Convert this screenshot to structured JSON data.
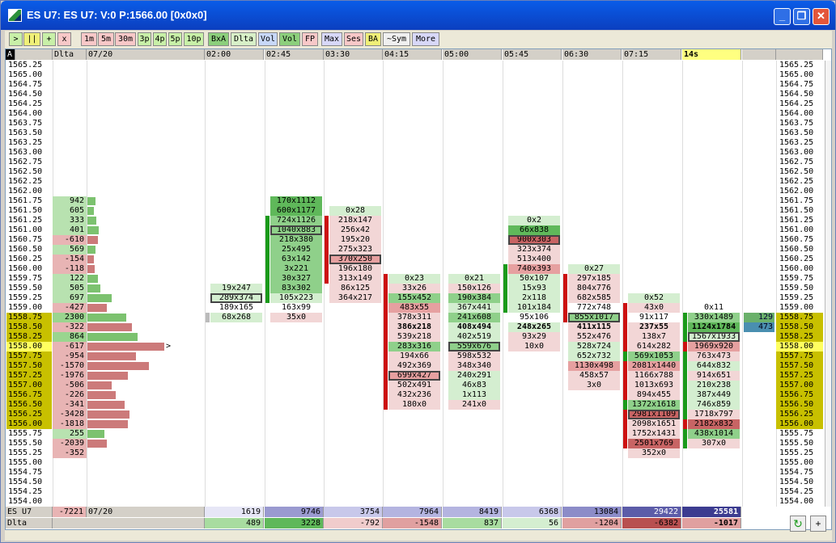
{
  "window": {
    "title": "ES U7: ES U7: V:0 P:1566.00 [0x0x0]"
  },
  "toolbar": {
    "buttons": [
      {
        "label": ">",
        "color": "#c8f0a8"
      },
      {
        "label": "||",
        "color": "#f0f078"
      },
      {
        "label": "+",
        "color": "#c8f0a8"
      },
      {
        "label": "x",
        "color": "#f8c8c8"
      },
      {
        "label": "1m",
        "color": "#f8c8c8"
      },
      {
        "label": "5m",
        "color": "#f8c8c8"
      },
      {
        "label": "30m",
        "color": "#f8c8c8"
      },
      {
        "label": "3p",
        "color": "#c8f0a8"
      },
      {
        "label": "4p",
        "color": "#c8f0a8"
      },
      {
        "label": "5p",
        "color": "#c8f0a8"
      },
      {
        "label": "10p",
        "color": "#c8f0a8"
      },
      {
        "label": "BxA",
        "color": "#8ccf7c"
      },
      {
        "label": "Dlta",
        "color": "#d8f0c8"
      },
      {
        "label": "Vol",
        "color": "#c8d8f8"
      },
      {
        "label": "Vol",
        "color": "#8ccf7c"
      },
      {
        "label": "FP",
        "color": "#f8c8c8"
      },
      {
        "label": "Max",
        "color": "#d8d8f8"
      },
      {
        "label": "Ses",
        "color": "#f8c8c8"
      },
      {
        "label": "BA",
        "color": "#f0f078"
      },
      {
        "label": "~Sym",
        "color": "#f0f0f0"
      },
      {
        "label": "More",
        "color": "#d8d8f8"
      }
    ]
  },
  "header": {
    "a": "A",
    "dlta": "Dlta",
    "date": "07/20",
    "times": [
      "02:00",
      "02:45",
      "03:30",
      "04:15",
      "05:00",
      "05:45",
      "06:30",
      "07:15",
      "14s"
    ]
  },
  "prices": [
    "1565.25",
    "1565.00",
    "1564.75",
    "1564.50",
    "1564.25",
    "1564.00",
    "1563.75",
    "1563.50",
    "1563.25",
    "1563.00",
    "1562.75",
    "1562.50",
    "1562.25",
    "1562.00",
    "1561.75",
    "1561.50",
    "1561.25",
    "1561.00",
    "1560.75",
    "1560.50",
    "1560.25",
    "1560.00",
    "1559.75",
    "1559.50",
    "1559.25",
    "1559.00",
    "1558.75",
    "1558.50",
    "1558.25",
    "1558.00",
    "1557.75",
    "1557.50",
    "1557.25",
    "1557.00",
    "1556.75",
    "1556.50",
    "1556.25",
    "1556.00",
    "1555.75",
    "1555.50",
    "1555.25",
    "1555.00",
    "1554.75",
    "1554.50",
    "1554.25",
    "1554.00"
  ],
  "highlight_prices": [
    "1558.75",
    "1558.50",
    "1558.25",
    "1557.75",
    "1557.50",
    "1557.25",
    "1557.00",
    "1556.75",
    "1556.50",
    "1556.25",
    "1556.00"
  ],
  "current_price": "1558.00",
  "deltas": {
    "1561.75": {
      "v": "942",
      "w": 10,
      "c": "g"
    },
    "1561.50": {
      "v": "605",
      "w": 8,
      "c": "g"
    },
    "1561.25": {
      "v": "333",
      "w": 11,
      "c": "g"
    },
    "1561.00": {
      "v": "401",
      "w": 14,
      "c": "g"
    },
    "1560.75": {
      "v": "-610",
      "w": 13,
      "c": "r"
    },
    "1560.50": {
      "v": "569",
      "w": 10,
      "c": "g"
    },
    "1560.25": {
      "v": "-154",
      "w": 8,
      "c": "r"
    },
    "1560.00": {
      "v": "-118",
      "w": 9,
      "c": "r"
    },
    "1559.75": {
      "v": "122",
      "w": 13,
      "c": "g"
    },
    "1559.50": {
      "v": "505",
      "w": 16,
      "c": "g"
    },
    "1559.25": {
      "v": "697",
      "w": 30,
      "c": "g"
    },
    "1559.00": {
      "v": "-427",
      "w": 24,
      "c": "r"
    },
    "1558.75": {
      "v": "2300",
      "w": 48,
      "c": "g"
    },
    "1558.50": {
      "v": "-322",
      "w": 55,
      "c": "r"
    },
    "1558.25": {
      "v": "864",
      "w": 62,
      "c": "g"
    },
    "1558.00": {
      "v": "-617",
      "w": 95,
      "c": "r"
    },
    "1557.75": {
      "v": "-954",
      "w": 60,
      "c": "r"
    },
    "1557.50": {
      "v": "-1570",
      "w": 76,
      "c": "r"
    },
    "1557.25": {
      "v": "-1976",
      "w": 50,
      "c": "r"
    },
    "1557.00": {
      "v": "-506",
      "w": 30,
      "c": "r"
    },
    "1556.75": {
      "v": "-226",
      "w": 35,
      "c": "r"
    },
    "1556.50": {
      "v": "-341",
      "w": 46,
      "c": "r"
    },
    "1556.25": {
      "v": "-3428",
      "w": 52,
      "c": "r"
    },
    "1556.00": {
      "v": "-1818",
      "w": 50,
      "c": "r"
    },
    "1555.75": {
      "v": "255",
      "w": 21,
      "c": "g"
    },
    "1555.50": {
      "v": "-2039",
      "w": 24,
      "c": "r"
    },
    "1555.25": {
      "v": "-352",
      "w": 0,
      "c": "r"
    }
  },
  "columns": [
    {
      "cells": {
        "1559.50": [
          "19x247",
          "g1"
        ],
        "1559.25": [
          "289x374",
          "g1b"
        ],
        "1559.00": [
          "189x165",
          "w"
        ],
        "1558.75": [
          "68x268",
          "g1"
        ]
      },
      "marks": {
        "1558.75": "grey"
      }
    },
    {
      "cells": {
        "1561.75": [
          "170x1112",
          "g3"
        ],
        "1561.50": [
          "600x1177",
          "g3"
        ],
        "1561.25": [
          "724x1126",
          "g2"
        ],
        "1561.00": [
          "1040x883",
          "g2b"
        ],
        "1560.75": [
          "218x380",
          "g2"
        ],
        "1560.50": [
          "25x495",
          "g2"
        ],
        "1560.25": [
          "63x142",
          "g2"
        ],
        "1560.00": [
          "3x221",
          "g2"
        ],
        "1559.75": [
          "30x327",
          "g2"
        ],
        "1559.50": [
          "83x302",
          "g2"
        ],
        "1559.25": [
          "105x223",
          "g1"
        ],
        "1559.00": [
          "163x99",
          "w"
        ],
        "1558.75": [
          "35x0",
          "r1"
        ]
      },
      "marks": {
        "1561.25": "g",
        "1561.00": "g",
        "1560.75": "g",
        "1560.50": "g",
        "1560.25": "g",
        "1560.00": "g",
        "1559.75": "g",
        "1559.50": "g",
        "1559.25": "g"
      }
    },
    {
      "cells": {
        "1561.50": [
          "0x28",
          "g1"
        ],
        "1561.25": [
          "218x147",
          "r1"
        ],
        "1561.00": [
          "256x42",
          "r1"
        ],
        "1560.75": [
          "195x20",
          "r1"
        ],
        "1560.50": [
          "275x323",
          "r1"
        ],
        "1560.25": [
          "370x250",
          "r2b"
        ],
        "1560.00": [
          "196x180",
          "r1"
        ],
        "1559.75": [
          "313x149",
          "r1"
        ],
        "1559.50": [
          "86x125",
          "r1"
        ],
        "1559.25": [
          "364x217",
          "r1"
        ]
      },
      "marks": {
        "1561.25": "r",
        "1561.00": "r",
        "1560.75": "r",
        "1560.50": "r",
        "1560.25": "r",
        "1560.00": "r",
        "1559.75": "r"
      }
    },
    {
      "cells": {
        "1559.75": [
          "0x23",
          "g1"
        ],
        "1559.50": [
          "33x26",
          "r1"
        ],
        "1559.25": [
          "155x452",
          "g2"
        ],
        "1559.00": [
          "483x55",
          "r2"
        ],
        "1558.75": [
          "378x311",
          "r1"
        ],
        "1558.50": [
          "386x218",
          "r1"
        ],
        "1558.25": [
          "539x218",
          "r1"
        ],
        "1558.00": [
          "283x316",
          "g2"
        ],
        "1557.75": [
          "194x66",
          "r1"
        ],
        "1557.50": [
          "492x369",
          "r1"
        ],
        "1557.25": [
          "699x427",
          "r2b"
        ],
        "1557.00": [
          "502x491",
          "r1"
        ],
        "1556.75": [
          "432x236",
          "r1"
        ],
        "1556.50": [
          "180x0",
          "r1"
        ]
      },
      "marks": {
        "1559.75": "r",
        "1559.50": "r",
        "1559.25": "r",
        "1559.00": "r",
        "1558.75": "r",
        "1558.50": "r",
        "1558.25": "r",
        "1558.00": "r",
        "1557.75": "r",
        "1557.50": "r",
        "1557.25": "r",
        "1557.00": "r",
        "1556.75": "r",
        "1556.50": "r"
      },
      "bold": [
        "1558.50"
      ]
    },
    {
      "cells": {
        "1559.75": [
          "0x21",
          "g1"
        ],
        "1559.50": [
          "150x126",
          "r1"
        ],
        "1559.25": [
          "190x384",
          "g2"
        ],
        "1559.00": [
          "367x441",
          "g1"
        ],
        "1558.75": [
          "241x608",
          "g2"
        ],
        "1558.50": [
          "408x494",
          "g1"
        ],
        "1558.25": [
          "402x519",
          "g1"
        ],
        "1558.00": [
          "559x676",
          "g2b"
        ],
        "1557.75": [
          "598x532",
          "r1"
        ],
        "1557.50": [
          "348x340",
          "r1"
        ],
        "1557.25": [
          "240x291",
          "g1"
        ],
        "1557.00": [
          "46x83",
          "g1"
        ],
        "1556.75": [
          "1x113",
          "g1"
        ],
        "1556.50": [
          "241x0",
          "r1"
        ]
      },
      "marks": {},
      "bold": [
        "1558.50"
      ]
    },
    {
      "cells": {
        "1561.25": [
          "0x2",
          "g1"
        ],
        "1561.00": [
          "66x838",
          "g3"
        ],
        "1560.75": [
          "900x303",
          "r3b"
        ],
        "1560.50": [
          "323x374",
          "r1"
        ],
        "1560.25": [
          "513x400",
          "r1"
        ],
        "1560.00": [
          "740x393",
          "r2"
        ],
        "1559.75": [
          "50x107",
          "g1"
        ],
        "1559.50": [
          "15x93",
          "g1"
        ],
        "1559.25": [
          "2x118",
          "g1"
        ],
        "1559.00": [
          "101x184",
          "g1"
        ],
        "1558.75": [
          "95x106",
          "w"
        ],
        "1558.50": [
          "248x265",
          "g1"
        ],
        "1558.25": [
          "93x29",
          "r1"
        ],
        "1558.00": [
          "10x0",
          "r1"
        ]
      },
      "marks": {
        "1560.00": "g",
        "1559.75": "g",
        "1559.50": "g",
        "1559.25": "g",
        "1559.00": "g"
      },
      "bold": [
        "1558.50"
      ]
    },
    {
      "cells": {
        "1560.00": [
          "0x27",
          "g1"
        ],
        "1559.75": [
          "297x185",
          "r1"
        ],
        "1559.50": [
          "804x776",
          "r1"
        ],
        "1559.25": [
          "682x585",
          "r1"
        ],
        "1559.00": [
          "772x748",
          "w"
        ],
        "1558.75": [
          "855x1017",
          "g2b"
        ],
        "1558.50": [
          "411x115",
          "r1"
        ],
        "1558.25": [
          "552x476",
          "r1"
        ],
        "1558.00": [
          "528x724",
          "g1"
        ],
        "1557.75": [
          "652x732",
          "g1"
        ],
        "1557.50": [
          "1130x498",
          "r2"
        ],
        "1557.25": [
          "458x57",
          "r1"
        ],
        "1557.00": [
          "3x0",
          "r1"
        ]
      },
      "marks": {
        "1559.75": "r",
        "1559.50": "r",
        "1559.25": "r",
        "1559.00": "r",
        "1558.75": "r"
      },
      "bold": [
        "1558.50"
      ]
    },
    {
      "cells": {
        "1559.25": [
          "0x52",
          "g1"
        ],
        "1559.00": [
          "43x0",
          "r1"
        ],
        "1558.75": [
          "91x117",
          "w"
        ],
        "1558.50": [
          "237x55",
          "r1"
        ],
        "1558.25": [
          "138x7",
          "r1"
        ],
        "1558.00": [
          "614x282",
          "r1"
        ],
        "1557.75": [
          "569x1053",
          "g2"
        ],
        "1557.50": [
          "2081x1440",
          "r2"
        ],
        "1557.25": [
          "1166x788",
          "r1"
        ],
        "1557.00": [
          "1013x693",
          "r1"
        ],
        "1556.75": [
          "894x455",
          "r1"
        ],
        "1556.50": [
          "1372x1618",
          "g2"
        ],
        "1556.25": [
          "2981x1109",
          "r3b"
        ],
        "1556.00": [
          "2098x1651",
          "r1"
        ],
        "1555.75": [
          "1752x1431",
          "r1"
        ],
        "1555.50": [
          "2501x769",
          "r3"
        ],
        "1555.25": [
          "352x0",
          "r1"
        ]
      },
      "marks": {
        "1559.00": "r",
        "1558.75": "r",
        "1558.50": "r",
        "1558.25": "r",
        "1558.00": "r",
        "1557.75": "g",
        "1557.50": "r",
        "1557.25": "r",
        "1557.00": "r",
        "1556.75": "r",
        "1556.50": "g",
        "1556.25": "r",
        "1556.00": "r",
        "1555.75": "r",
        "1555.50": "r"
      },
      "bold": [
        "1558.50"
      ]
    },
    {
      "cells": {
        "1559.00": [
          "0x11",
          "w"
        ],
        "1558.75": [
          "330x1489",
          "g2"
        ],
        "1558.50": [
          "1124x1784",
          "g3"
        ],
        "1558.25": [
          "1567x1933",
          "g1b"
        ],
        "1558.00": [
          "1969x920",
          "r2"
        ],
        "1557.75": [
          "763x473",
          "r1"
        ],
        "1557.50": [
          "644x832",
          "g1"
        ],
        "1557.25": [
          "914x651",
          "r1"
        ],
        "1557.00": [
          "210x238",
          "g1"
        ],
        "1556.75": [
          "387x449",
          "g1"
        ],
        "1556.50": [
          "746x859",
          "g1"
        ],
        "1556.25": [
          "1718x797",
          "r1"
        ],
        "1556.00": [
          "2182x832",
          "r3"
        ],
        "1555.75": [
          "438x1014",
          "g2"
        ],
        "1555.50": [
          "307x0",
          "r1"
        ]
      },
      "marks": {
        "1558.75": "g",
        "1558.50": "g",
        "1558.25": "g",
        "1558.00": "r",
        "1557.75": "g",
        "1557.50": "g",
        "1557.25": "g",
        "1557.00": "g",
        "1556.75": "g",
        "1556.50": "g",
        "1556.25": "g",
        "1556.00": "r",
        "1555.75": "g",
        "1555.50": "g"
      },
      "bold": [
        "1558.50"
      ]
    }
  ],
  "live": {
    "ask": "129",
    "bid": "473"
  },
  "footer": {
    "sym": "ES U7",
    "delta_total": "-7221",
    "date": "07/20",
    "vol_label": "",
    "dlta_label": "Dlta",
    "volumes": [
      "1619",
      "9746",
      "3754",
      "7964",
      "8419",
      "6368",
      "13084",
      "29422",
      "25581"
    ],
    "deltas": [
      "489",
      "3228",
      "-792",
      "-1548",
      "837",
      "56",
      "-1204",
      "-6382",
      "-1017"
    ]
  },
  "colors": {
    "g1": "#d4eed0",
    "g2": "#8fd08a",
    "g3": "#5fb85a",
    "r1": "#f2d6d6",
    "r2": "#e6a0a0",
    "r3": "#c86464",
    "w": "#ffffff",
    "highlight": "#c8c000",
    "current": "#ffff60",
    "mark_g": "#1a9a1a",
    "mark_r": "#cc1111"
  }
}
